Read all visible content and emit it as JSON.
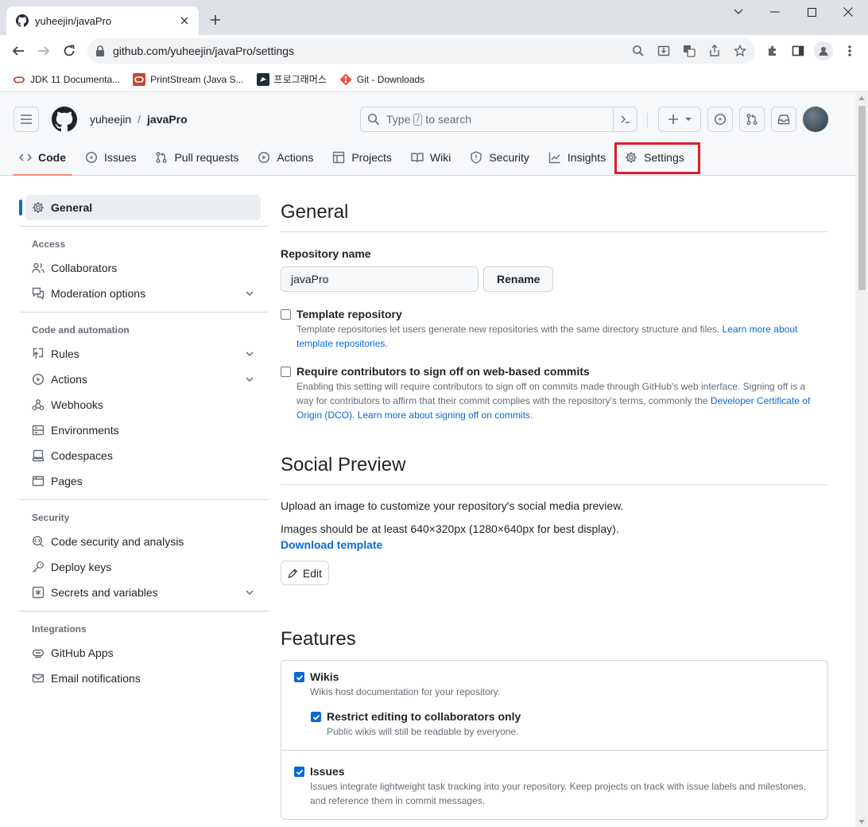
{
  "browser": {
    "tab_title": "yuheejin/javaPro",
    "url": "github.com/yuheejin/javaPro/settings",
    "bookmarks": [
      {
        "label": "JDK 11 Documenta..."
      },
      {
        "label": "PrintStream (Java S..."
      },
      {
        "label": "프로그래머스"
      },
      {
        "label": "Git - Downloads"
      }
    ]
  },
  "header": {
    "owner": "yuheejin",
    "separator": "/",
    "repo": "javaPro",
    "search_prefix": "Type",
    "search_key": "/",
    "search_suffix": "to search"
  },
  "repo_nav": {
    "code": "Code",
    "issues": "Issues",
    "pull_requests": "Pull requests",
    "actions": "Actions",
    "projects": "Projects",
    "wiki": "Wiki",
    "security": "Security",
    "insights": "Insights",
    "settings": "Settings"
  },
  "sidebar": {
    "general": "General",
    "access_heading": "Access",
    "collaborators": "Collaborators",
    "moderation": "Moderation options",
    "automation_heading": "Code and automation",
    "rules": "Rules",
    "actions": "Actions",
    "webhooks": "Webhooks",
    "environments": "Environments",
    "codespaces": "Codespaces",
    "pages": "Pages",
    "security_heading": "Security",
    "code_security": "Code security and analysis",
    "deploy_keys": "Deploy keys",
    "secrets": "Secrets and variables",
    "integrations_heading": "Integrations",
    "github_apps": "GitHub Apps",
    "email_notifications": "Email notifications"
  },
  "general": {
    "title": "General",
    "repo_name_label": "Repository name",
    "repo_name_value": "javaPro",
    "rename_button": "Rename",
    "template_label": "Template repository",
    "template_desc": "Template repositories let users generate new repositories with the same directory structure and files.",
    "template_link_1": "Learn more about",
    "template_link_2": "template repositories",
    "template_end": ".",
    "signoff_label": "Require contributors to sign off on web-based commits",
    "signoff_desc_1": "Enabling this setting will require contributors to sign off on commits made through GitHub's web interface. Signing off is a",
    "signoff_desc_2": "way for contributors to affirm that their commit complies with the repository's terms, commonly the",
    "signoff_link_dco_1": "Developer Certificate of",
    "signoff_link_dco_2": "Origin (DCO)",
    "signoff_dot": ".",
    "signoff_link_learn": "Learn more about signing off on commits",
    "signoff_end": "."
  },
  "social": {
    "title": "Social Preview",
    "desc": "Upload an image to customize your repository's social media preview.",
    "size_note": "Images should be at least 640×320px (1280×640px for best display).",
    "download_link": "Download template",
    "edit_button": "Edit"
  },
  "features": {
    "title": "Features",
    "wikis_label": "Wikis",
    "wikis_desc": "Wikis host documentation for your repository.",
    "restrict_label": "Restrict editing to collaborators only",
    "restrict_desc": "Public wikis will still be readable by everyone.",
    "issues_label": "Issues",
    "issues_desc_1": "Issues integrate lightweight task tracking into your repository. Keep projects on track with issue labels and milestones,",
    "issues_desc_2": "and reference them in commit messages."
  },
  "colors": {
    "highlight": "#e11d2a",
    "accent": "#0969da",
    "tab_underline": "#fd8c73"
  }
}
